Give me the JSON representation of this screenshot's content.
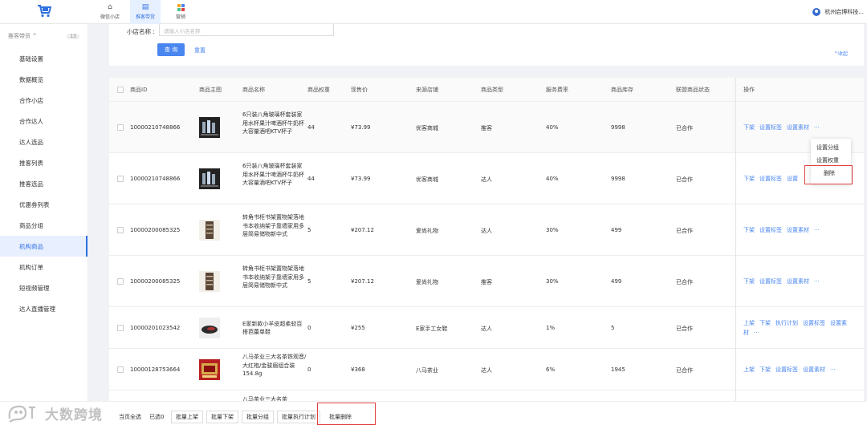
{
  "topbar": {
    "nav": [
      {
        "label": "微信小店",
        "icon": "home-icon"
      },
      {
        "label": "推客带货",
        "icon": "store-icon"
      },
      {
        "label": "营销",
        "icon": "grid-icon"
      }
    ],
    "user_name": "杭州启博科技..."
  },
  "sidebar": {
    "section": "推客带货",
    "section_count": "13",
    "items": [
      "基础设置",
      "数据概览",
      "合作小店",
      "合作达人",
      "达人选品",
      "推客列表",
      "推客选品",
      "优惠券列表",
      "商品分组",
      "机构商品",
      "机构订单",
      "短视频管理",
      "达人直播管理"
    ],
    "active_index": 9
  },
  "filter": {
    "shop_label": "小店名称 :",
    "shop_placeholder": "请输入小店名称",
    "query_button": "查 询",
    "reset_button": "重置",
    "collapse": "^收起"
  },
  "table": {
    "headers": [
      "商品ID",
      "商品主图",
      "商品名称",
      "商品权重",
      "现售价",
      "来源店铺",
      "商品类型",
      "服务费率",
      "商品库存",
      "联盟商品状态",
      "操作"
    ],
    "rows": [
      {
        "id": "10000210748866",
        "name": "6只装八角玻璃杯套装家用水杯果汁啤酒杯牛奶杯大容量酒吧KTV杯子",
        "weight": "44",
        "price": "¥73.99",
        "shop": "优客商城",
        "type": "推客",
        "rate": "40%",
        "stock": "9998",
        "status": "已合作",
        "ops": [
          "下架",
          "设置标签",
          "设置素材",
          "···"
        ],
        "thumb": "cups"
      },
      {
        "id": "10000210748866",
        "name": "6只装八角玻璃杯套装家用水杯果汁啤酒杯牛奶杯大容量酒吧KTV杯子",
        "weight": "44",
        "price": "¥73.99",
        "shop": "优客商城",
        "type": "达人",
        "rate": "40%",
        "stock": "9998",
        "status": "已合作",
        "ops": [
          "下架",
          "设置标签",
          "设置"
        ],
        "thumb": "cups"
      },
      {
        "id": "10000200085325",
        "name": "转角书柜书架置物架落地书本收纳架子靠墙家用多层简易储物新中式",
        "weight": "5",
        "price": "¥207.12",
        "shop": "爱尚礼物",
        "type": "达人",
        "rate": "30%",
        "stock": "499",
        "status": "已合作",
        "ops": [
          "下架",
          "设置标签",
          "设置素材",
          "···"
        ],
        "thumb": "shelf"
      },
      {
        "id": "10000200085325",
        "name": "转角书柜书架置物架落地书本收纳架子靠墙家用多层简易储物新中式",
        "weight": "5",
        "price": "¥207.12",
        "shop": "爱尚礼物",
        "type": "推客",
        "rate": "30%",
        "stock": "499",
        "status": "已合作",
        "ops": [
          "下架",
          "设置标签",
          "设置素材",
          "···"
        ],
        "thumb": "shelf"
      },
      {
        "id": "10000201023542",
        "name": "E家新款小羊皮超柔软百搭芭蕾单鞋",
        "weight": "0",
        "price": "¥255",
        "shop": "E家手工女鞋",
        "type": "达人",
        "rate": "1%",
        "stock": "5",
        "status": "已合作",
        "ops": [
          "上架",
          "下架",
          "执行计划",
          "设置标签",
          "设置素材",
          "···"
        ],
        "thumb": "shoe"
      },
      {
        "id": "10000128753664",
        "name": "八马茶业三大名茶铁观音/大红袍/金骏眉组合装154.8g",
        "weight": "0",
        "price": "¥368",
        "shop": "八马茶业",
        "type": "达人",
        "rate": "6%",
        "stock": "1945",
        "status": "已合作",
        "ops": [
          "上架",
          "下架",
          "设置标签",
          "设置素材",
          "···"
        ],
        "thumb": "tea"
      }
    ],
    "partial_row_text": "八马茶业三大名茶"
  },
  "dropdown": {
    "items": [
      "设置分组",
      "设置权重",
      "删除"
    ]
  },
  "bottom": {
    "select_page": "当页全选",
    "selected": "已选0",
    "buttons": [
      "批量上架",
      "批量下架",
      "批量分组",
      "批量执行计划",
      "批量删除"
    ]
  },
  "watermark": "大数跨境",
  "colors": {
    "accent": "#4a86f0",
    "highlight": "#e04040"
  }
}
